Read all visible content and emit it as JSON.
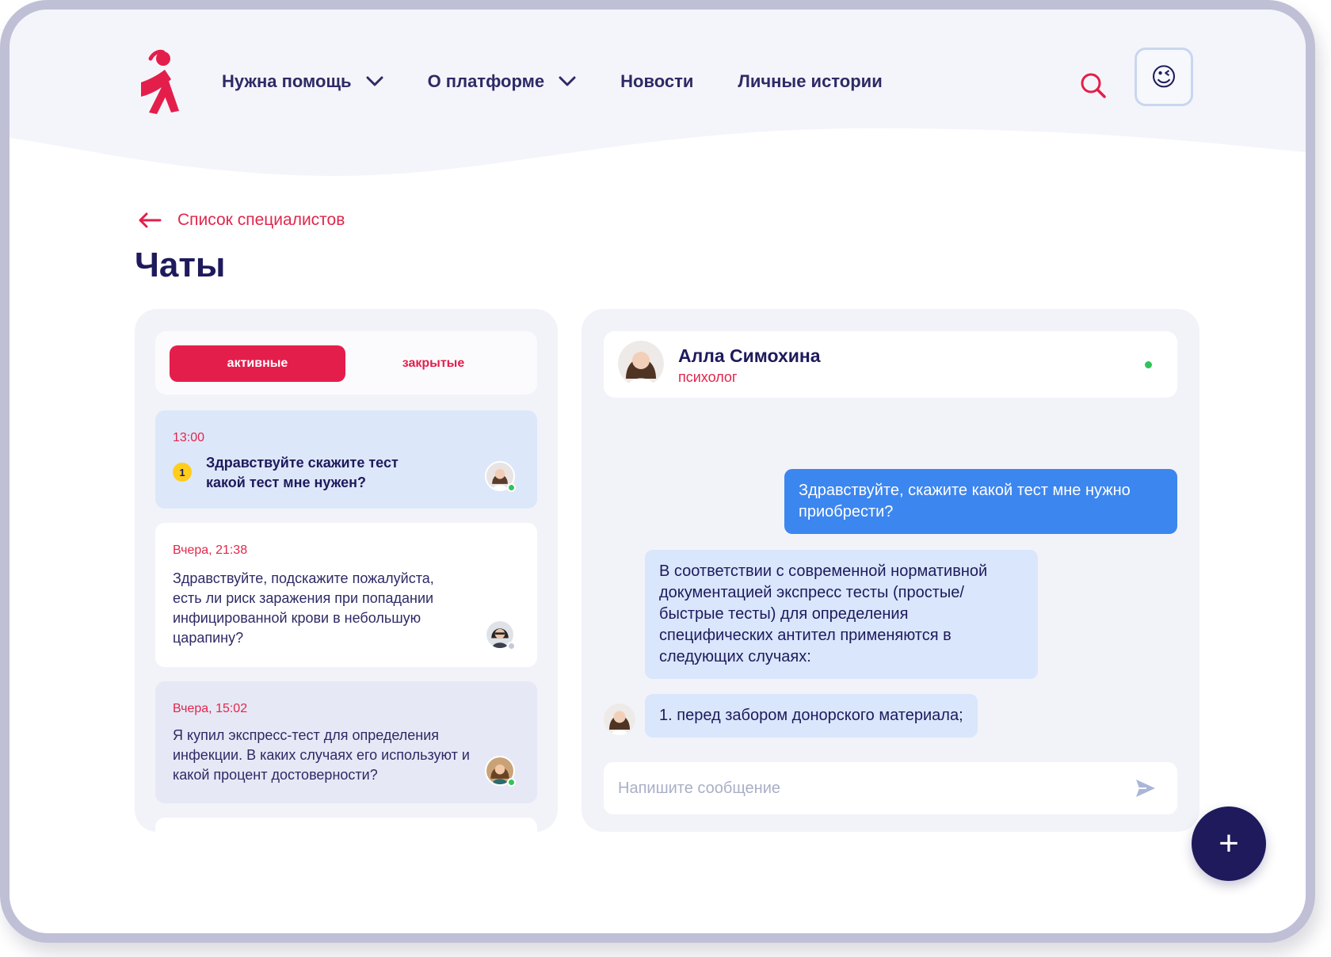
{
  "header": {
    "nav": [
      {
        "label": "Нужна помощь",
        "has_dropdown": true
      },
      {
        "label": "О платформе",
        "has_dropdown": true
      },
      {
        "label": "Новости",
        "has_dropdown": false
      },
      {
        "label": "Личные истории",
        "has_dropdown": false
      }
    ],
    "search_icon": "search-icon",
    "profile_emoji": "😉"
  },
  "breadcrumb": {
    "back_label": "Список специалистов"
  },
  "page_title": "Чаты",
  "tabs": {
    "active": "активные",
    "closed": "закрытые"
  },
  "chat_list": [
    {
      "time": "13:00",
      "unread": "1",
      "message": "Здравствуйте скажите тест какой тест мне нужен?",
      "status": "online",
      "selected": true
    },
    {
      "time": "Вчера, 21:38",
      "message": "Здравствуйте, подскажите пожалуйста, есть ли риск заражения при попадании инфицированной крови в небольшую царапину?",
      "status": "offline",
      "selected": false
    },
    {
      "time": "Вчера, 15:02",
      "message": "Я купил экспресс-тест для определения инфекции. В каких случаях его используют и какой процент достоверности?",
      "status": "online",
      "selected": false
    }
  ],
  "conversation": {
    "contact_name": "Алла Симохина",
    "contact_role": "психолог",
    "contact_status": "online",
    "messages": [
      {
        "direction": "out",
        "text": "Здравствуйте, скажите какой тест мне нужно приобрести?"
      },
      {
        "direction": "in",
        "text": "В соответствии с современной нормативной документацией экспресс тесты (простые/быстрые тесты) для определения специфических антител применяются в следующих случаях:"
      },
      {
        "direction": "in",
        "text": "1. перед забором донорского материала;"
      }
    ],
    "composer_placeholder": "Напишите сообщение"
  },
  "fab_label": "+",
  "colors": {
    "brand_red": "#e41e4b",
    "navy": "#1e1a5c",
    "bubble_out": "#3c86ef",
    "bubble_in": "#d9e6fb",
    "online": "#32c35a",
    "unread_badge": "#ffcd1b"
  }
}
